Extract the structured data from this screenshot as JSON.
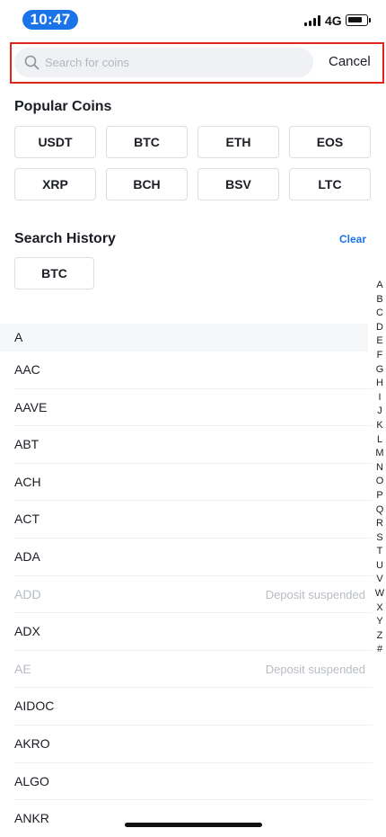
{
  "status_bar": {
    "time": "10:47",
    "network": "4G"
  },
  "search": {
    "placeholder": "Search for coins",
    "value": "",
    "cancel_label": "Cancel"
  },
  "popular": {
    "title": "Popular Coins",
    "coins": [
      "USDT",
      "BTC",
      "ETH",
      "EOS",
      "XRP",
      "BCH",
      "BSV",
      "LTC"
    ]
  },
  "history": {
    "title": "Search History",
    "clear_label": "Clear",
    "items": [
      "BTC"
    ]
  },
  "index_letters": [
    "A",
    "B",
    "C",
    "D",
    "E",
    "F",
    "G",
    "H",
    "I",
    "J",
    "K",
    "L",
    "M",
    "N",
    "O",
    "P",
    "Q",
    "R",
    "S",
    "T",
    "U",
    "V",
    "W",
    "X",
    "Y",
    "Z",
    "#"
  ],
  "list": {
    "group_label": "A",
    "coins": [
      {
        "name": "AAC",
        "status": ""
      },
      {
        "name": "AAVE",
        "status": ""
      },
      {
        "name": "ABT",
        "status": ""
      },
      {
        "name": "ACH",
        "status": ""
      },
      {
        "name": "ACT",
        "status": ""
      },
      {
        "name": "ADA",
        "status": ""
      },
      {
        "name": "ADD",
        "status": "Deposit suspended"
      },
      {
        "name": "ADX",
        "status": ""
      },
      {
        "name": "AE",
        "status": "Deposit suspended"
      },
      {
        "name": "AIDOC",
        "status": ""
      },
      {
        "name": "AKRO",
        "status": ""
      },
      {
        "name": "ALGO",
        "status": ""
      },
      {
        "name": "ANKR",
        "status": ""
      }
    ]
  },
  "colors": {
    "accent": "#1a73e8",
    "highlight_border": "#e0251b",
    "muted": "#b7bcc4"
  }
}
